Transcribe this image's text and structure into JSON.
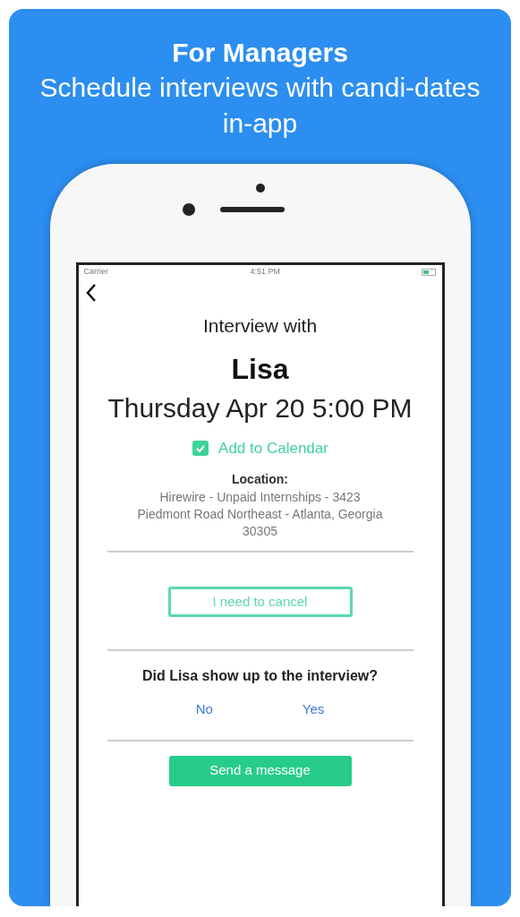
{
  "header": {
    "title": "For Managers",
    "subtitle": "Schedule interviews with candi-dates in-app"
  },
  "status_bar": {
    "carrier": "Carrier",
    "time": "4:51 PM"
  },
  "interview": {
    "intro": "Interview with",
    "name": "Lisa",
    "datetime": "Thursday Apr 20 5:00 PM",
    "add_to_calendar": "Add to Calendar",
    "location_label": "Location:",
    "location": "Hirewire - Unpaid Internships - 3423 Piedmont Road Northeast - Atlanta, Georgia 30305"
  },
  "cancel_button": "I need to cancel",
  "attendance": {
    "question": "Did Lisa show up to the interview?",
    "options": [
      {
        "label": "No"
      },
      {
        "label": "Yes"
      }
    ]
  },
  "message_button": "Send a message"
}
